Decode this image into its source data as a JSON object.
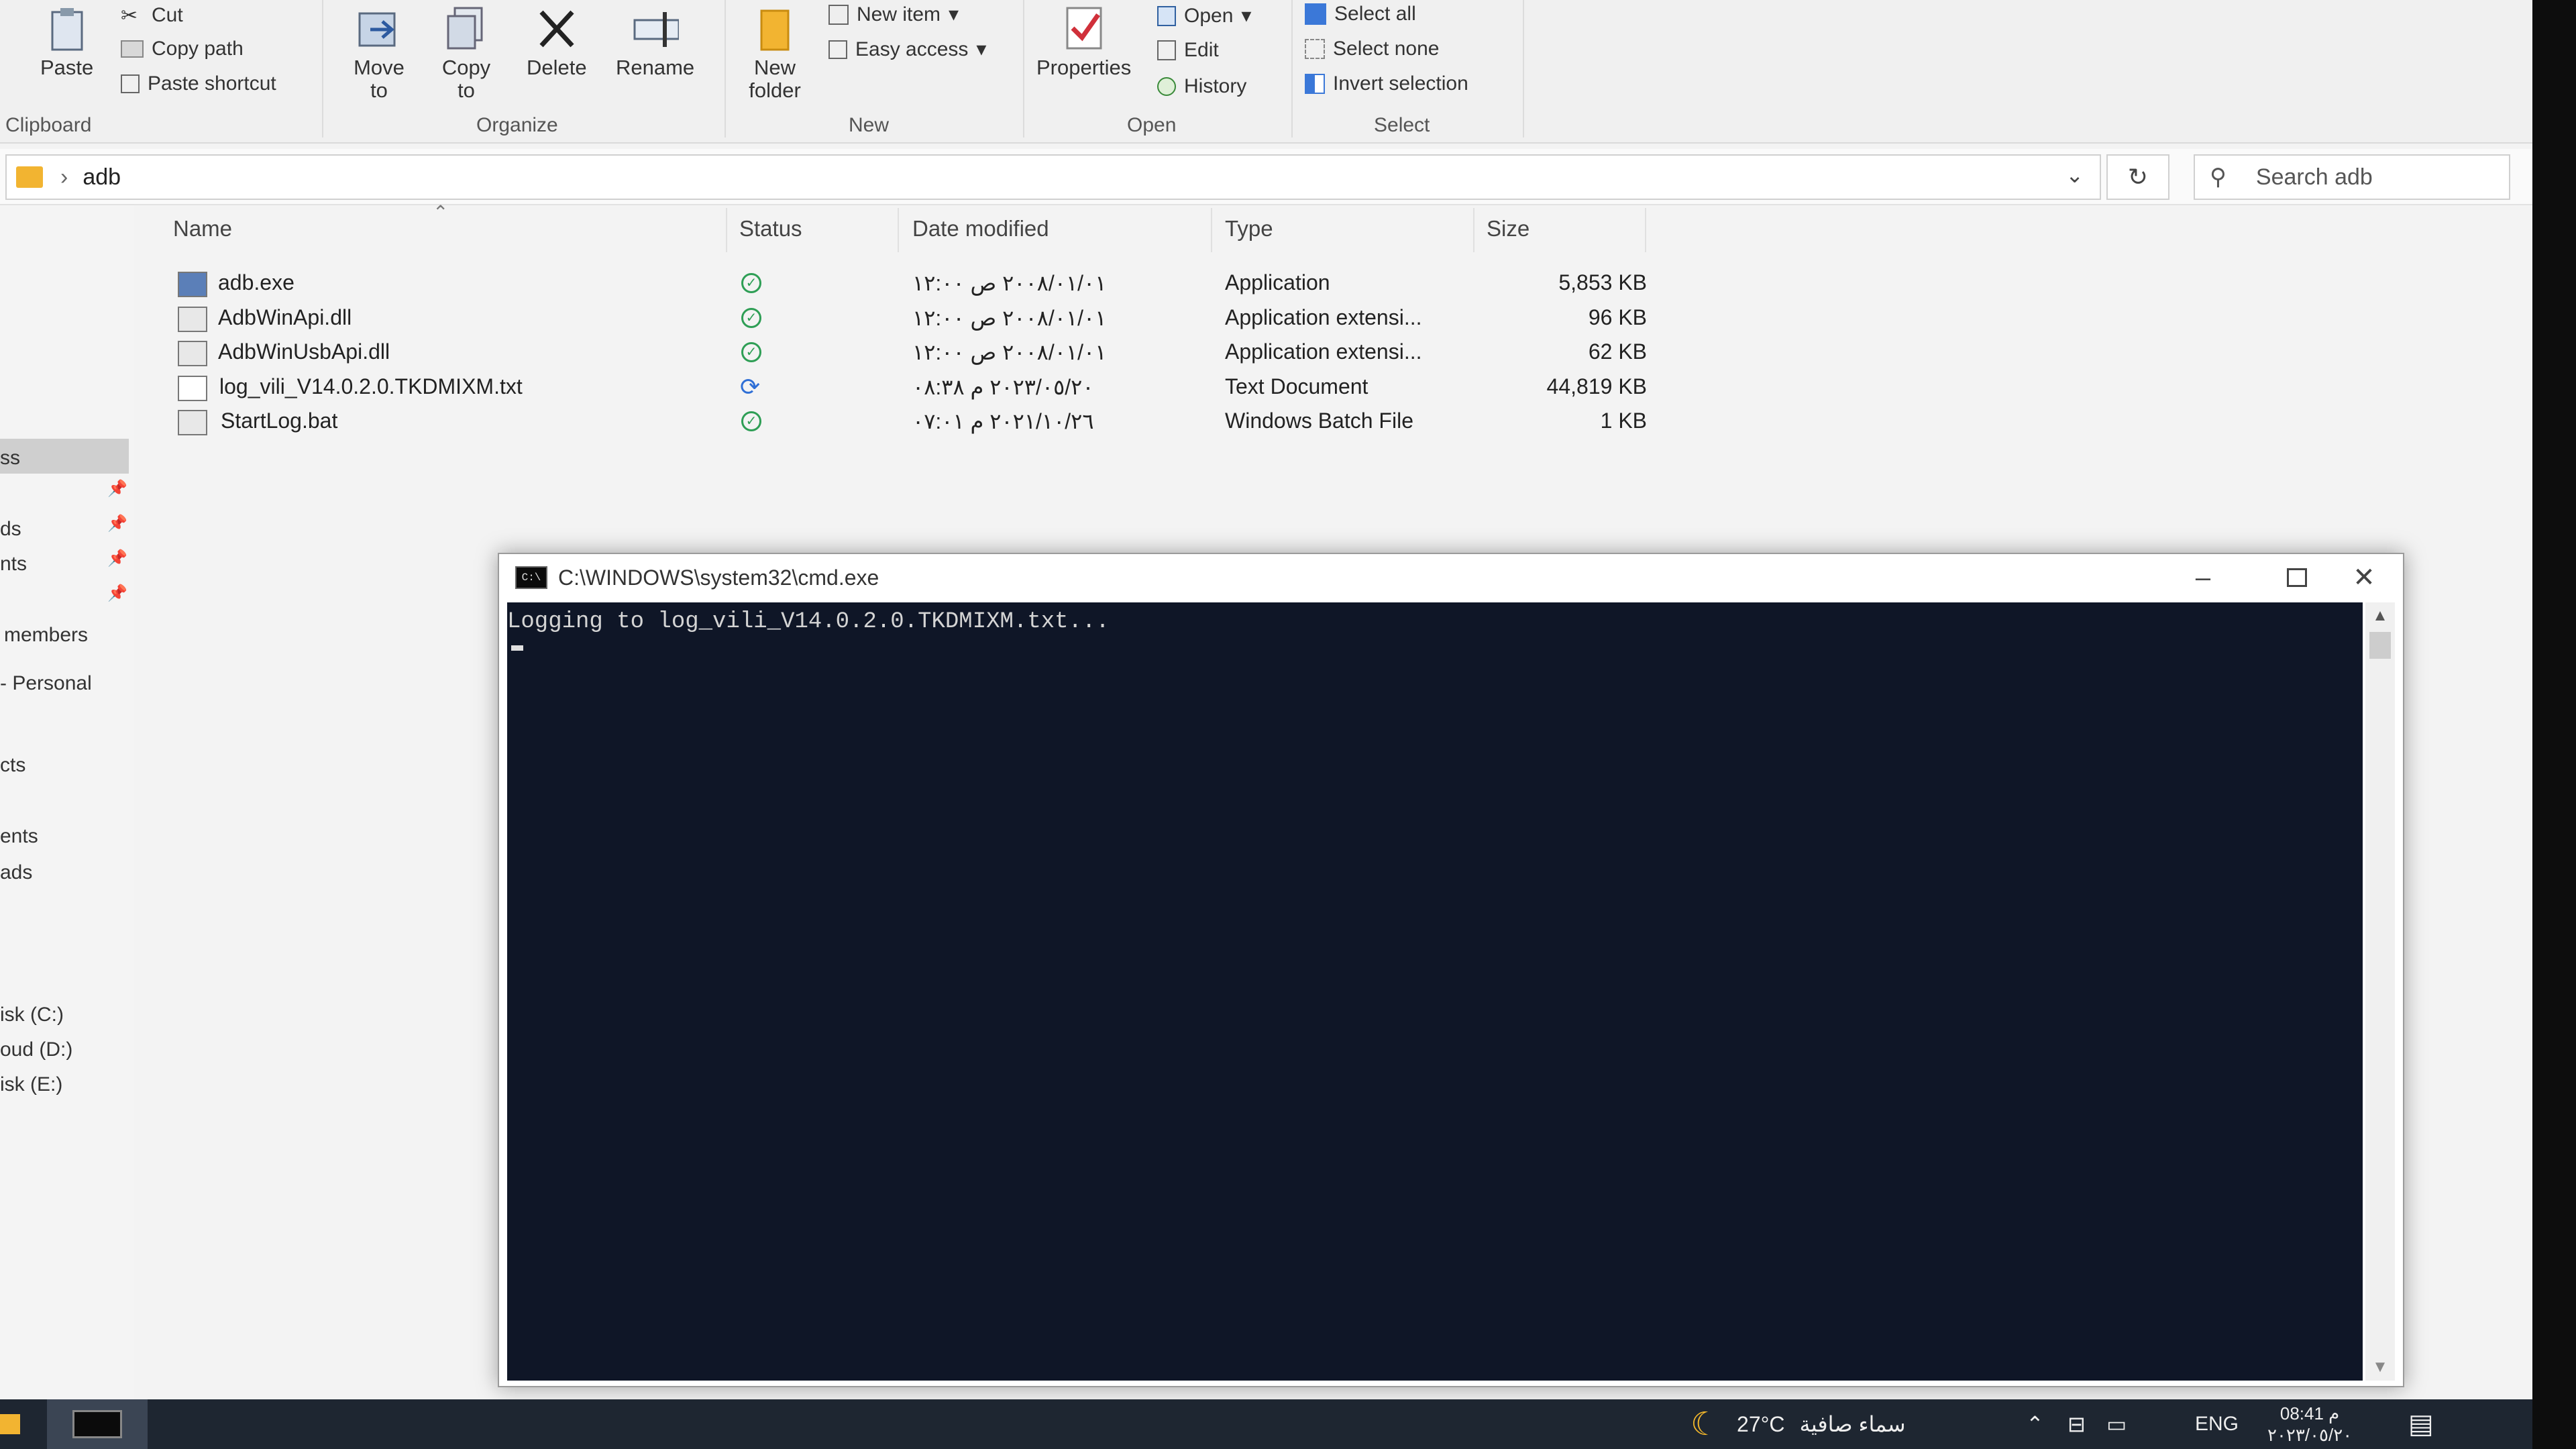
{
  "ribbon": {
    "clipboard": {
      "paste": "Paste",
      "cut": "Cut",
      "copy_path": "Copy path",
      "paste_shortcut": "Paste shortcut",
      "group": "Clipboard"
    },
    "organize": {
      "move_to": "Move to",
      "copy_to": "Copy to",
      "delete": "Delete",
      "rename": "Rename",
      "group": "Organize"
    },
    "new": {
      "new_folder": "New folder",
      "new_item": "New item",
      "easy_access": "Easy access",
      "group": "New"
    },
    "open": {
      "properties": "Properties",
      "open": "Open",
      "edit": "Edit",
      "history": "History",
      "group": "Open"
    },
    "select": {
      "select_all": "Select all",
      "select_none": "Select none",
      "invert_selection": "Invert selection",
      "group": "Select"
    }
  },
  "address": {
    "path": "adb",
    "search_placeholder": "Search adb"
  },
  "nav": {
    "items": [
      "ss",
      "ds",
      "nts",
      "members",
      "- Personal",
      "cts",
      "ents",
      "ads",
      "isk (C:)",
      "oud (D:)",
      "isk (E:)"
    ]
  },
  "columns": {
    "name": "Name",
    "status": "Status",
    "date": "Date modified",
    "type": "Type",
    "size": "Size"
  },
  "files": [
    {
      "name": "adb.exe",
      "status": "ok",
      "date": "٢٠٠٨/٠١/٠١ ص ١٢:٠٠",
      "type": "Application",
      "size": "5,853 KB"
    },
    {
      "name": "AdbWinApi.dll",
      "status": "ok",
      "date": "٢٠٠٨/٠١/٠١ ص ١٢:٠٠",
      "type": "Application extensi...",
      "size": "96 KB"
    },
    {
      "name": "AdbWinUsbApi.dll",
      "status": "ok",
      "date": "٢٠٠٨/٠١/٠١ ص ١٢:٠٠",
      "type": "Application extensi...",
      "size": "62 KB"
    },
    {
      "name": "log_vili_V14.0.2.0.TKDMIXM.txt",
      "status": "sync",
      "date": "٢٠٢٣/٠٥/٢٠ م ٠٨:٣٨",
      "type": "Text Document",
      "size": "44,819 KB"
    },
    {
      "name": "StartLog.bat",
      "status": "ok",
      "date": "٢٠٢١/١٠/٢٦ م ٠٧:٠١",
      "type": "Windows Batch File",
      "size": "1 KB"
    }
  ],
  "cmd": {
    "title": "C:\\WINDOWS\\system32\\cmd.exe",
    "output": "Logging to log_vili_V14.0.2.0.TKDMIXM.txt..."
  },
  "taskbar": {
    "temperature": "27°C",
    "weather": "سماء صافية",
    "language": "ENG",
    "time": "08:41 م",
    "date": "٢٠٢٣/٠٥/٢٠"
  },
  "colors": {
    "console_bg": "#0f1627",
    "status_ok": "#2e9e55",
    "status_sync": "#2f6fd6",
    "folder": "#f2b431"
  }
}
